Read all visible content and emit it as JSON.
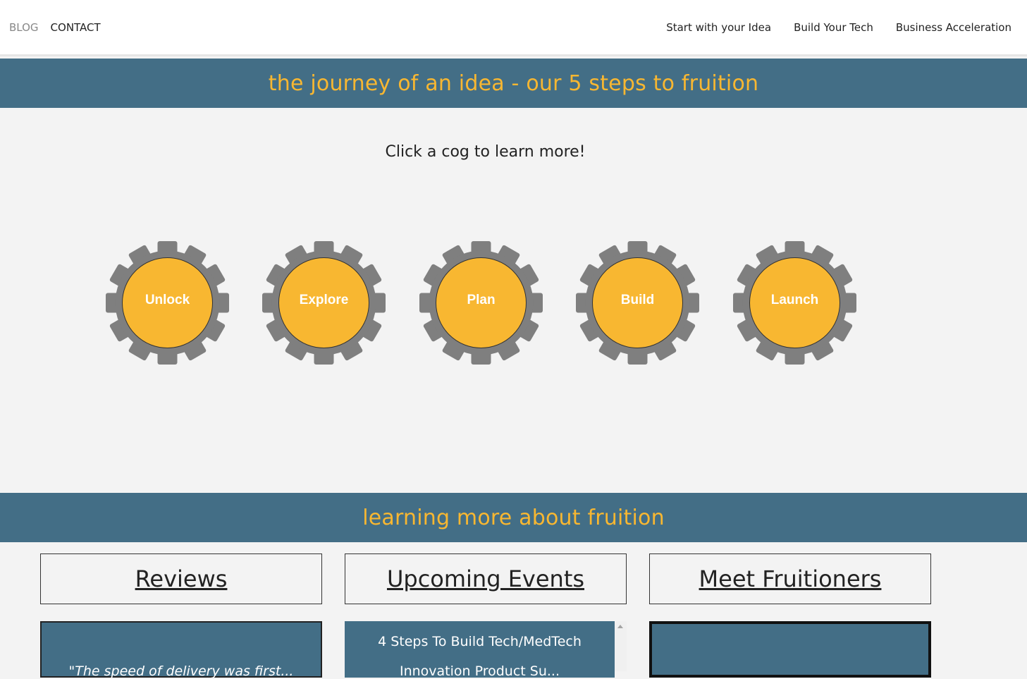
{
  "nav": {
    "left": [
      "BLOG",
      "CONTACT"
    ],
    "right": [
      "Start with your Idea",
      "Build Your Tech",
      "Business Acceleration"
    ]
  },
  "journey": {
    "heading": "the journey of an idea - our 5 steps to fruition",
    "hint": "Click a cog to learn more!",
    "cogs": [
      "Unlock",
      "Explore",
      "Plan",
      "Build",
      "Launch"
    ]
  },
  "learning": {
    "heading": "learning more about fruition",
    "tabs": [
      "Reviews",
      "Upcoming Events",
      "Meet Fruitioners"
    ],
    "events": [
      "4 Steps To Build Tech/MedTech",
      "Innovation Product Su..."
    ],
    "review_snippet": "\"The speed of delivery was first..."
  },
  "colors": {
    "band": "#436e86",
    "accent": "#f8b731",
    "cog_gray": "#7f7f7f",
    "cog_center": "#f8b731"
  }
}
